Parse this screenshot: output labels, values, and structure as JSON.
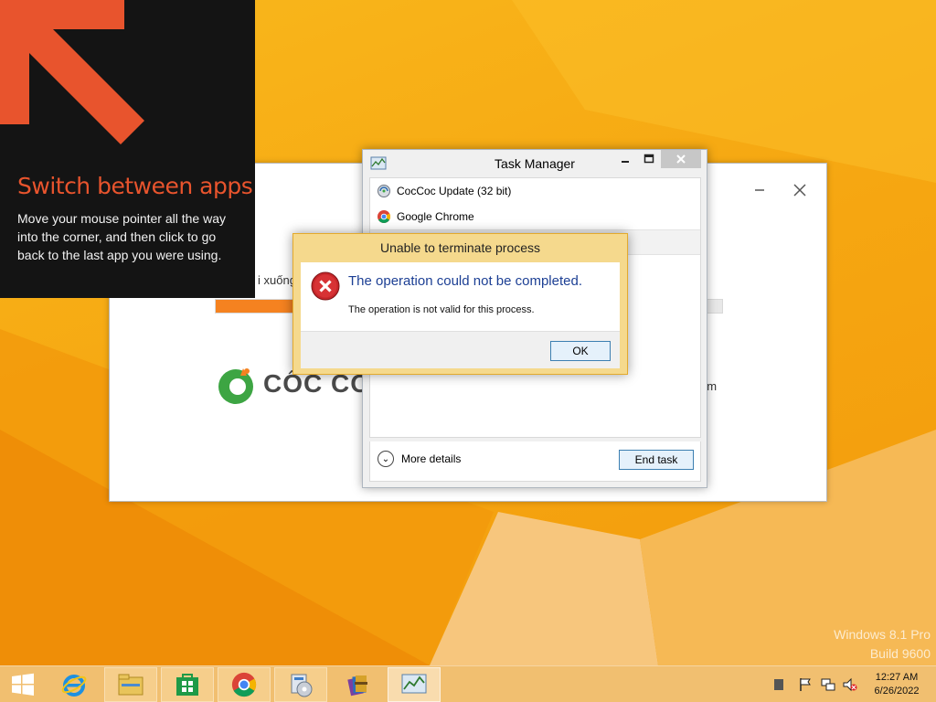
{
  "tip": {
    "title": "Switch between apps",
    "body": "Move your mouse pointer all the way into the corner, and then click to go back to the last app you were using.",
    "accent": "#e8542d"
  },
  "installer": {
    "status_text": "i xuống",
    "brand": "CỐC CỐC",
    "site_fragment": "om",
    "progress_percent": 22,
    "accent": "#f58220",
    "icons": {
      "minimize": "minimize-icon",
      "close": "close-icon",
      "logo": "coccoc-logo-icon"
    }
  },
  "task_manager": {
    "title": "Task Manager",
    "apps": [
      {
        "name": "CocCoc Update (32 bit)",
        "icon": "coccoc-update-icon"
      },
      {
        "name": "Google Chrome",
        "icon": "chrome-icon"
      }
    ],
    "more_details": "More details",
    "end_task": "End task"
  },
  "error_dialog": {
    "title": "Unable to terminate process",
    "main_instruction": "The operation could not be completed.",
    "detail": "The operation is not valid for this process.",
    "ok": "OK",
    "icon": "error-icon"
  },
  "watermark": {
    "line1": "Windows 8.1 Pro",
    "line2": "Build 9600"
  },
  "taskbar": {
    "items": [
      {
        "name": "start-button",
        "icon": "windows-logo-icon"
      },
      {
        "name": "internet-explorer",
        "icon": "ie-icon"
      },
      {
        "name": "file-explorer",
        "icon": "folder-icon"
      },
      {
        "name": "windows-store",
        "icon": "store-icon"
      },
      {
        "name": "google-chrome",
        "icon": "chrome-icon"
      },
      {
        "name": "coccoc-setup",
        "icon": "setup-icon"
      },
      {
        "name": "winrar",
        "icon": "winrar-icon"
      },
      {
        "name": "task-manager",
        "icon": "task-manager-icon"
      }
    ],
    "clock": {
      "time": "12:27 AM",
      "date": "6/26/2022"
    }
  }
}
